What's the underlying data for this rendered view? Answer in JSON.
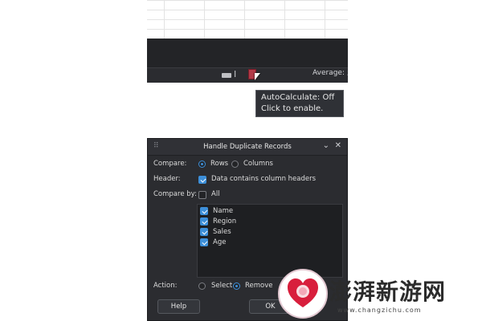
{
  "status_bar": {
    "average_label": "Average: ;"
  },
  "tooltip": {
    "line1": "AutoCalculate: Off",
    "line2": "Click to enable."
  },
  "dialog": {
    "title": "Handle Duplicate Records",
    "compare_label": "Compare:",
    "compare_options": {
      "rows": "Rows",
      "columns": "Columns",
      "selected": "rows"
    },
    "header_label": "Header:",
    "header_checkbox": {
      "label": "Data contains column headers",
      "checked": true
    },
    "compare_by_label": "Compare by:",
    "all_checkbox": {
      "label": "All",
      "checked": false
    },
    "columns": [
      {
        "label": "Name",
        "checked": true
      },
      {
        "label": "Region",
        "checked": true
      },
      {
        "label": "Sales",
        "checked": true
      },
      {
        "label": "Age",
        "checked": true
      }
    ],
    "action_label": "Action:",
    "action_options": {
      "select": "Select",
      "remove": "Remove",
      "selected": "remove"
    },
    "help_button": "Help",
    "ok_button": "OK"
  },
  "watermark": {
    "text": "澎湃新游网",
    "url": "www.changzichu.com"
  },
  "colors": {
    "accent": "#3d8fd9",
    "dialog_bg": "#2b2c30",
    "list_bg": "#1e1f22"
  }
}
